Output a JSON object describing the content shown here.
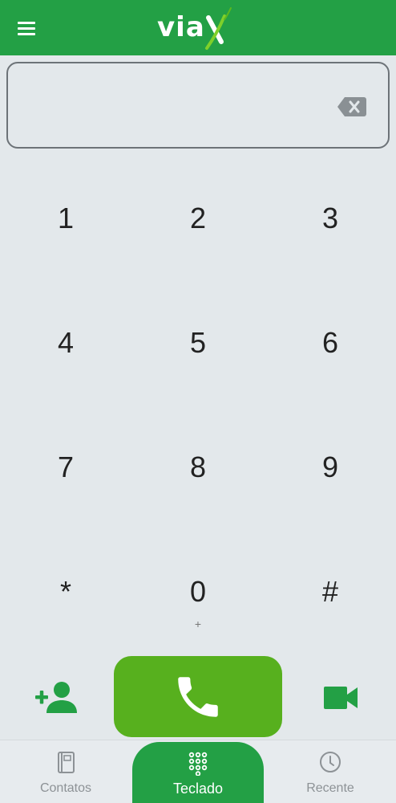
{
  "app": {
    "logo_text": "via",
    "brand_color": "#23a045",
    "accent_color": "#57b01e"
  },
  "header": {
    "menu_icon": "hamburger-menu-icon"
  },
  "display": {
    "value": "",
    "backspace_icon": "backspace-icon"
  },
  "keypad": {
    "keys": [
      {
        "digit": "1",
        "sub": ""
      },
      {
        "digit": "2",
        "sub": ""
      },
      {
        "digit": "3",
        "sub": ""
      },
      {
        "digit": "4",
        "sub": ""
      },
      {
        "digit": "5",
        "sub": ""
      },
      {
        "digit": "6",
        "sub": ""
      },
      {
        "digit": "7",
        "sub": ""
      },
      {
        "digit": "8",
        "sub": ""
      },
      {
        "digit": "9",
        "sub": ""
      },
      {
        "digit": "*",
        "sub": ""
      },
      {
        "digit": "0",
        "sub": "+"
      },
      {
        "digit": "#",
        "sub": ""
      }
    ]
  },
  "actions": {
    "add_contact_icon": "add-contact-icon",
    "call_icon": "phone-icon",
    "video_icon": "video-camera-icon"
  },
  "bottom_nav": {
    "items": [
      {
        "label": "Contatos",
        "icon": "contacts-book-icon",
        "active": false
      },
      {
        "label": "Teclado",
        "icon": "dialpad-icon",
        "active": true
      },
      {
        "label": "Recente",
        "icon": "clock-icon",
        "active": false
      }
    ]
  }
}
